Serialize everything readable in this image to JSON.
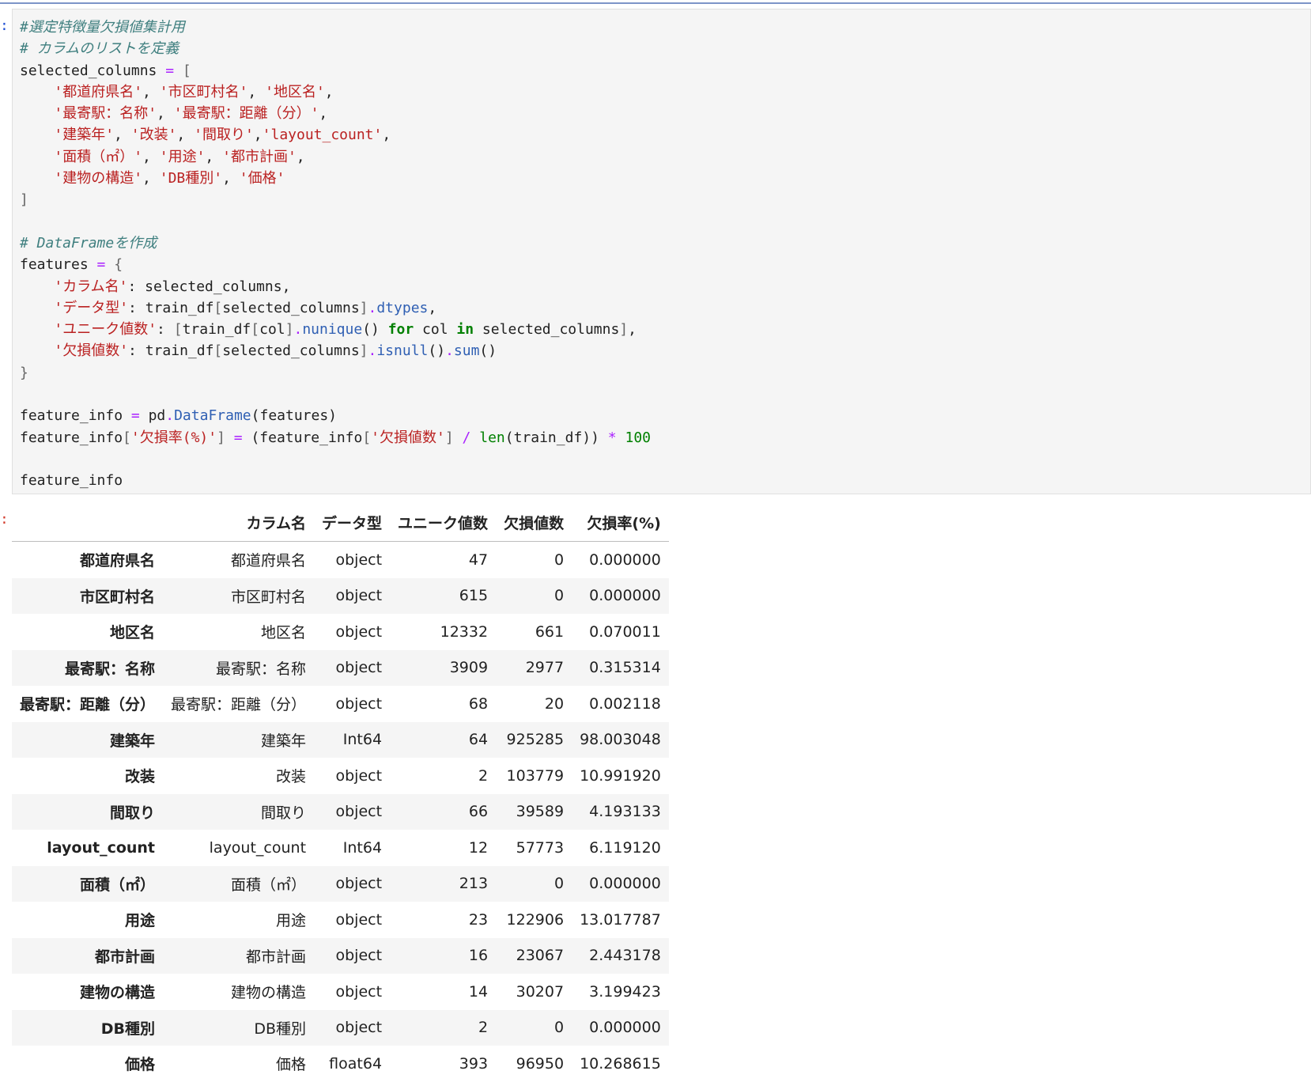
{
  "prompts": {
    "input_marker": ":",
    "output_marker": ":"
  },
  "code": {
    "lines": [
      [
        {
          "c": "t-comment",
          "t": "#選定特徴量欠損値集計用"
        }
      ],
      [
        {
          "c": "t-comment",
          "t": "# カラムのリストを定義"
        }
      ],
      [
        {
          "c": "t-var",
          "t": "selected_columns "
        },
        {
          "c": "t-op",
          "t": "="
        },
        {
          "c": "t-var",
          "t": " "
        },
        {
          "c": "t-paren",
          "t": "["
        }
      ],
      [
        {
          "c": "t-var",
          "t": "    "
        },
        {
          "c": "t-str",
          "t": "'都道府県名'"
        },
        {
          "c": "t-var",
          "t": ", "
        },
        {
          "c": "t-str",
          "t": "'市区町村名'"
        },
        {
          "c": "t-var",
          "t": ", "
        },
        {
          "c": "t-str",
          "t": "'地区名'"
        },
        {
          "c": "t-var",
          "t": ","
        }
      ],
      [
        {
          "c": "t-var",
          "t": "    "
        },
        {
          "c": "t-str",
          "t": "'最寄駅：名称'"
        },
        {
          "c": "t-var",
          "t": ", "
        },
        {
          "c": "t-str",
          "t": "'最寄駅：距離（分）'"
        },
        {
          "c": "t-var",
          "t": ","
        }
      ],
      [
        {
          "c": "t-var",
          "t": "    "
        },
        {
          "c": "t-str",
          "t": "'建築年'"
        },
        {
          "c": "t-var",
          "t": ", "
        },
        {
          "c": "t-str",
          "t": "'改装'"
        },
        {
          "c": "t-var",
          "t": ", "
        },
        {
          "c": "t-str",
          "t": "'間取り'"
        },
        {
          "c": "t-var",
          "t": ","
        },
        {
          "c": "t-str",
          "t": "'layout_count'"
        },
        {
          "c": "t-var",
          "t": ","
        }
      ],
      [
        {
          "c": "t-var",
          "t": "    "
        },
        {
          "c": "t-str",
          "t": "'面積（㎡）'"
        },
        {
          "c": "t-var",
          "t": ", "
        },
        {
          "c": "t-str",
          "t": "'用途'"
        },
        {
          "c": "t-var",
          "t": ", "
        },
        {
          "c": "t-str",
          "t": "'都市計画'"
        },
        {
          "c": "t-var",
          "t": ","
        }
      ],
      [
        {
          "c": "t-var",
          "t": "    "
        },
        {
          "c": "t-str",
          "t": "'建物の構造'"
        },
        {
          "c": "t-var",
          "t": ", "
        },
        {
          "c": "t-str",
          "t": "'DB種別'"
        },
        {
          "c": "t-var",
          "t": ", "
        },
        {
          "c": "t-str",
          "t": "'価格'"
        }
      ],
      [
        {
          "c": "t-paren",
          "t": "]"
        }
      ],
      [],
      [
        {
          "c": "t-comment",
          "t": "# DataFrameを作成"
        }
      ],
      [
        {
          "c": "t-var",
          "t": "features "
        },
        {
          "c": "t-op",
          "t": "="
        },
        {
          "c": "t-var",
          "t": " "
        },
        {
          "c": "t-paren",
          "t": "{"
        }
      ],
      [
        {
          "c": "t-var",
          "t": "    "
        },
        {
          "c": "t-str",
          "t": "'カラム名'"
        },
        {
          "c": "t-var",
          "t": ": selected_columns,"
        }
      ],
      [
        {
          "c": "t-var",
          "t": "    "
        },
        {
          "c": "t-str",
          "t": "'データ型'"
        },
        {
          "c": "t-var",
          "t": ": train_df"
        },
        {
          "c": "t-paren",
          "t": "["
        },
        {
          "c": "t-var",
          "t": "selected_columns"
        },
        {
          "c": "t-paren",
          "t": "]"
        },
        {
          "c": "t-op",
          "t": "."
        },
        {
          "c": "t-attr",
          "t": "dtypes"
        },
        {
          "c": "t-var",
          "t": ","
        }
      ],
      [
        {
          "c": "t-var",
          "t": "    "
        },
        {
          "c": "t-str",
          "t": "'ユニーク値数'"
        },
        {
          "c": "t-var",
          "t": ": "
        },
        {
          "c": "t-paren",
          "t": "["
        },
        {
          "c": "t-var",
          "t": "train_df"
        },
        {
          "c": "t-paren",
          "t": "["
        },
        {
          "c": "t-var",
          "t": "col"
        },
        {
          "c": "t-paren",
          "t": "]"
        },
        {
          "c": "t-op",
          "t": "."
        },
        {
          "c": "t-attr",
          "t": "nunique"
        },
        {
          "c": "t-var",
          "t": "() "
        },
        {
          "c": "t-kw",
          "t": "for"
        },
        {
          "c": "t-var",
          "t": " col "
        },
        {
          "c": "t-kw",
          "t": "in"
        },
        {
          "c": "t-var",
          "t": " selected_columns"
        },
        {
          "c": "t-paren",
          "t": "]"
        },
        {
          "c": "t-var",
          "t": ","
        }
      ],
      [
        {
          "c": "t-var",
          "t": "    "
        },
        {
          "c": "t-str",
          "t": "'欠損値数'"
        },
        {
          "c": "t-var",
          "t": ": train_df"
        },
        {
          "c": "t-paren",
          "t": "["
        },
        {
          "c": "t-var",
          "t": "selected_columns"
        },
        {
          "c": "t-paren",
          "t": "]"
        },
        {
          "c": "t-op",
          "t": "."
        },
        {
          "c": "t-attr",
          "t": "isnull"
        },
        {
          "c": "t-var",
          "t": "()"
        },
        {
          "c": "t-op",
          "t": "."
        },
        {
          "c": "t-attr",
          "t": "sum"
        },
        {
          "c": "t-var",
          "t": "()"
        }
      ],
      [
        {
          "c": "t-paren",
          "t": "}"
        }
      ],
      [],
      [
        {
          "c": "t-var",
          "t": "feature_info "
        },
        {
          "c": "t-op",
          "t": "="
        },
        {
          "c": "t-var",
          "t": " pd"
        },
        {
          "c": "t-op",
          "t": "."
        },
        {
          "c": "t-attr",
          "t": "DataFrame"
        },
        {
          "c": "t-var",
          "t": "(features)"
        }
      ],
      [
        {
          "c": "t-var",
          "t": "feature_info"
        },
        {
          "c": "t-paren",
          "t": "["
        },
        {
          "c": "t-str",
          "t": "'欠損率(%)'"
        },
        {
          "c": "t-paren",
          "t": "]"
        },
        {
          "c": "t-var",
          "t": " "
        },
        {
          "c": "t-op",
          "t": "="
        },
        {
          "c": "t-var",
          "t": " (feature_info"
        },
        {
          "c": "t-paren",
          "t": "["
        },
        {
          "c": "t-str",
          "t": "'欠損値数'"
        },
        {
          "c": "t-paren",
          "t": "]"
        },
        {
          "c": "t-var",
          "t": " "
        },
        {
          "c": "t-op",
          "t": "/"
        },
        {
          "c": "t-var",
          "t": " "
        },
        {
          "c": "t-builtin",
          "t": "len"
        },
        {
          "c": "t-var",
          "t": "(train_df)) "
        },
        {
          "c": "t-op",
          "t": "*"
        },
        {
          "c": "t-var",
          "t": " "
        },
        {
          "c": "t-num",
          "t": "100"
        }
      ],
      [],
      [
        {
          "c": "t-var",
          "t": "feature_info"
        }
      ]
    ]
  },
  "table": {
    "headers": [
      "",
      "カラム名",
      "データ型",
      "ユニーク値数",
      "欠損値数",
      "欠損率(%)"
    ],
    "rows": [
      {
        "index": "都道府県名",
        "cells": [
          "都道府県名",
          "object",
          "47",
          "0",
          "0.000000"
        ]
      },
      {
        "index": "市区町村名",
        "cells": [
          "市区町村名",
          "object",
          "615",
          "0",
          "0.000000"
        ]
      },
      {
        "index": "地区名",
        "cells": [
          "地区名",
          "object",
          "12332",
          "661",
          "0.070011"
        ]
      },
      {
        "index": "最寄駅：名称",
        "cells": [
          "最寄駅：名称",
          "object",
          "3909",
          "2977",
          "0.315314"
        ]
      },
      {
        "index": "最寄駅：距離（分）",
        "cells": [
          "最寄駅：距離（分）",
          "object",
          "68",
          "20",
          "0.002118"
        ]
      },
      {
        "index": "建築年",
        "cells": [
          "建築年",
          "Int64",
          "64",
          "925285",
          "98.003048"
        ]
      },
      {
        "index": "改装",
        "cells": [
          "改装",
          "object",
          "2",
          "103779",
          "10.991920"
        ]
      },
      {
        "index": "間取り",
        "cells": [
          "間取り",
          "object",
          "66",
          "39589",
          "4.193133"
        ]
      },
      {
        "index": "layout_count",
        "cells": [
          "layout_count",
          "Int64",
          "12",
          "57773",
          "6.119120"
        ]
      },
      {
        "index": "面積（㎡）",
        "cells": [
          "面積（㎡）",
          "object",
          "213",
          "0",
          "0.000000"
        ]
      },
      {
        "index": "用途",
        "cells": [
          "用途",
          "object",
          "23",
          "122906",
          "13.017787"
        ]
      },
      {
        "index": "都市計画",
        "cells": [
          "都市計画",
          "object",
          "16",
          "23067",
          "2.443178"
        ]
      },
      {
        "index": "建物の構造",
        "cells": [
          "建物の構造",
          "object",
          "14",
          "30207",
          "3.199423"
        ]
      },
      {
        "index": "DB種別",
        "cells": [
          "DB種別",
          "object",
          "2",
          "0",
          "0.000000"
        ]
      },
      {
        "index": "価格",
        "cells": [
          "価格",
          "float64",
          "393",
          "96950",
          "10.268615"
        ]
      }
    ]
  }
}
